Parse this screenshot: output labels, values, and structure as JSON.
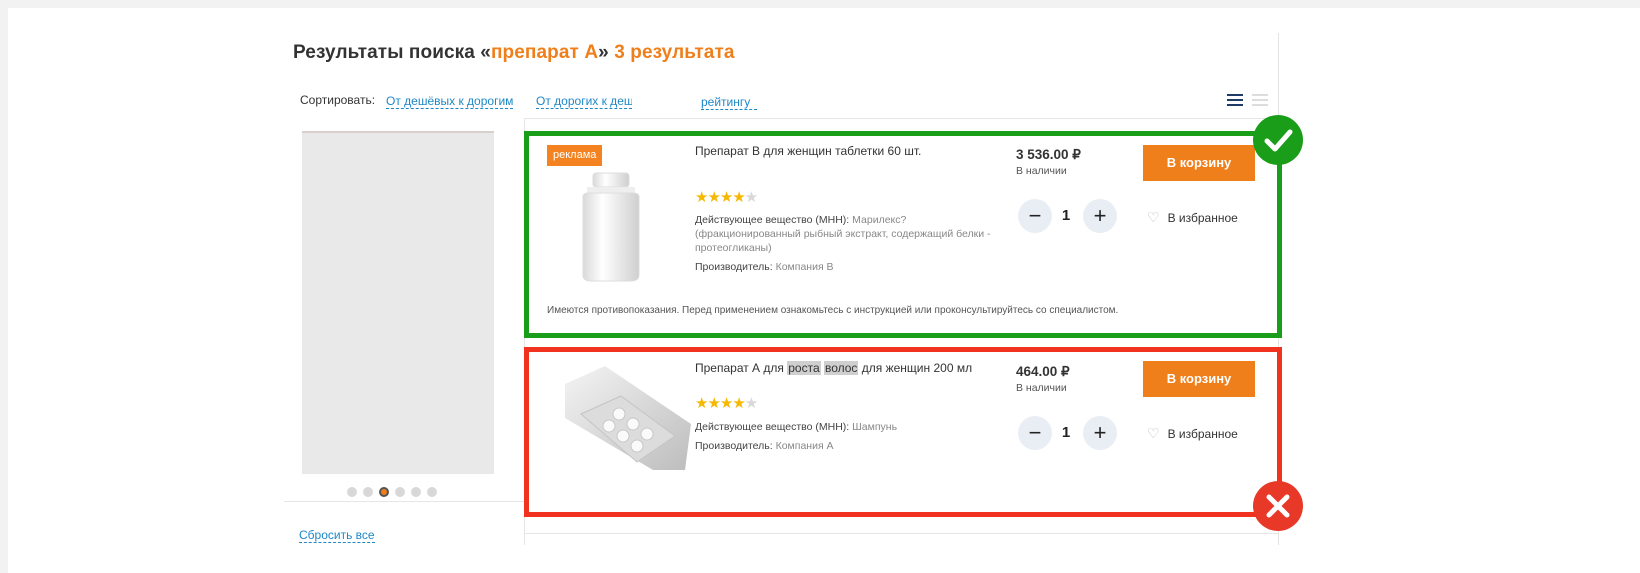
{
  "title": {
    "prefix": "Результаты поиска «",
    "query": "препарат А",
    "suffix": "» ",
    "count": "3 результата"
  },
  "sort": {
    "label": "Сортировать:",
    "options": [
      "От дешёвых к дорогим",
      "От дорогих к деш",
      "рейтингу"
    ]
  },
  "sidebar": {
    "reset_label": "Сбросить все",
    "carousel_dots": 6,
    "carousel_active": 3
  },
  "products": [
    {
      "ad_label": "реклама",
      "name": "Препарат В для женщин таблетки 60 шт.",
      "rating": 4,
      "attr_label": "Действующее вещество (МНН):",
      "attr_value_1": "Марилекс?",
      "attr_value_2": "(фракционированный рыбный экстракт, содержащий белки -",
      "attr_value_3": "протеогликаны)",
      "manufacturer_label": "Производитель:",
      "manufacturer_value": "Компания В",
      "price": "3 536.00 ₽",
      "stock": "В наличии",
      "cart_label": "В корзину",
      "qty": "1",
      "fav_label": "В избранное",
      "disclaimer": "Имеются противопоказания. Перед применением ознакомьтесь с инструкцией или проконсультируйтесь со специалистом."
    },
    {
      "name_part1": "Препарат А для ",
      "name_hl1": "роста",
      "name_space": " ",
      "name_hl2": "волос",
      "name_part2": " для женщин 200 мл",
      "rating": 4,
      "attr_label": "Действующее вещество (МНН):",
      "attr_value_1": "Шампунь",
      "manufacturer_label": "Производитель:",
      "manufacturer_value": "Компания А",
      "price": "464.00 ₽",
      "stock": "В наличии",
      "cart_label": "В корзину",
      "qty": "1",
      "fav_label": "В избранное"
    }
  ],
  "colors": {
    "accent": "#ef7f1a",
    "link": "#1e88c7",
    "good": "#1a9d19",
    "bad": "#e83828"
  }
}
